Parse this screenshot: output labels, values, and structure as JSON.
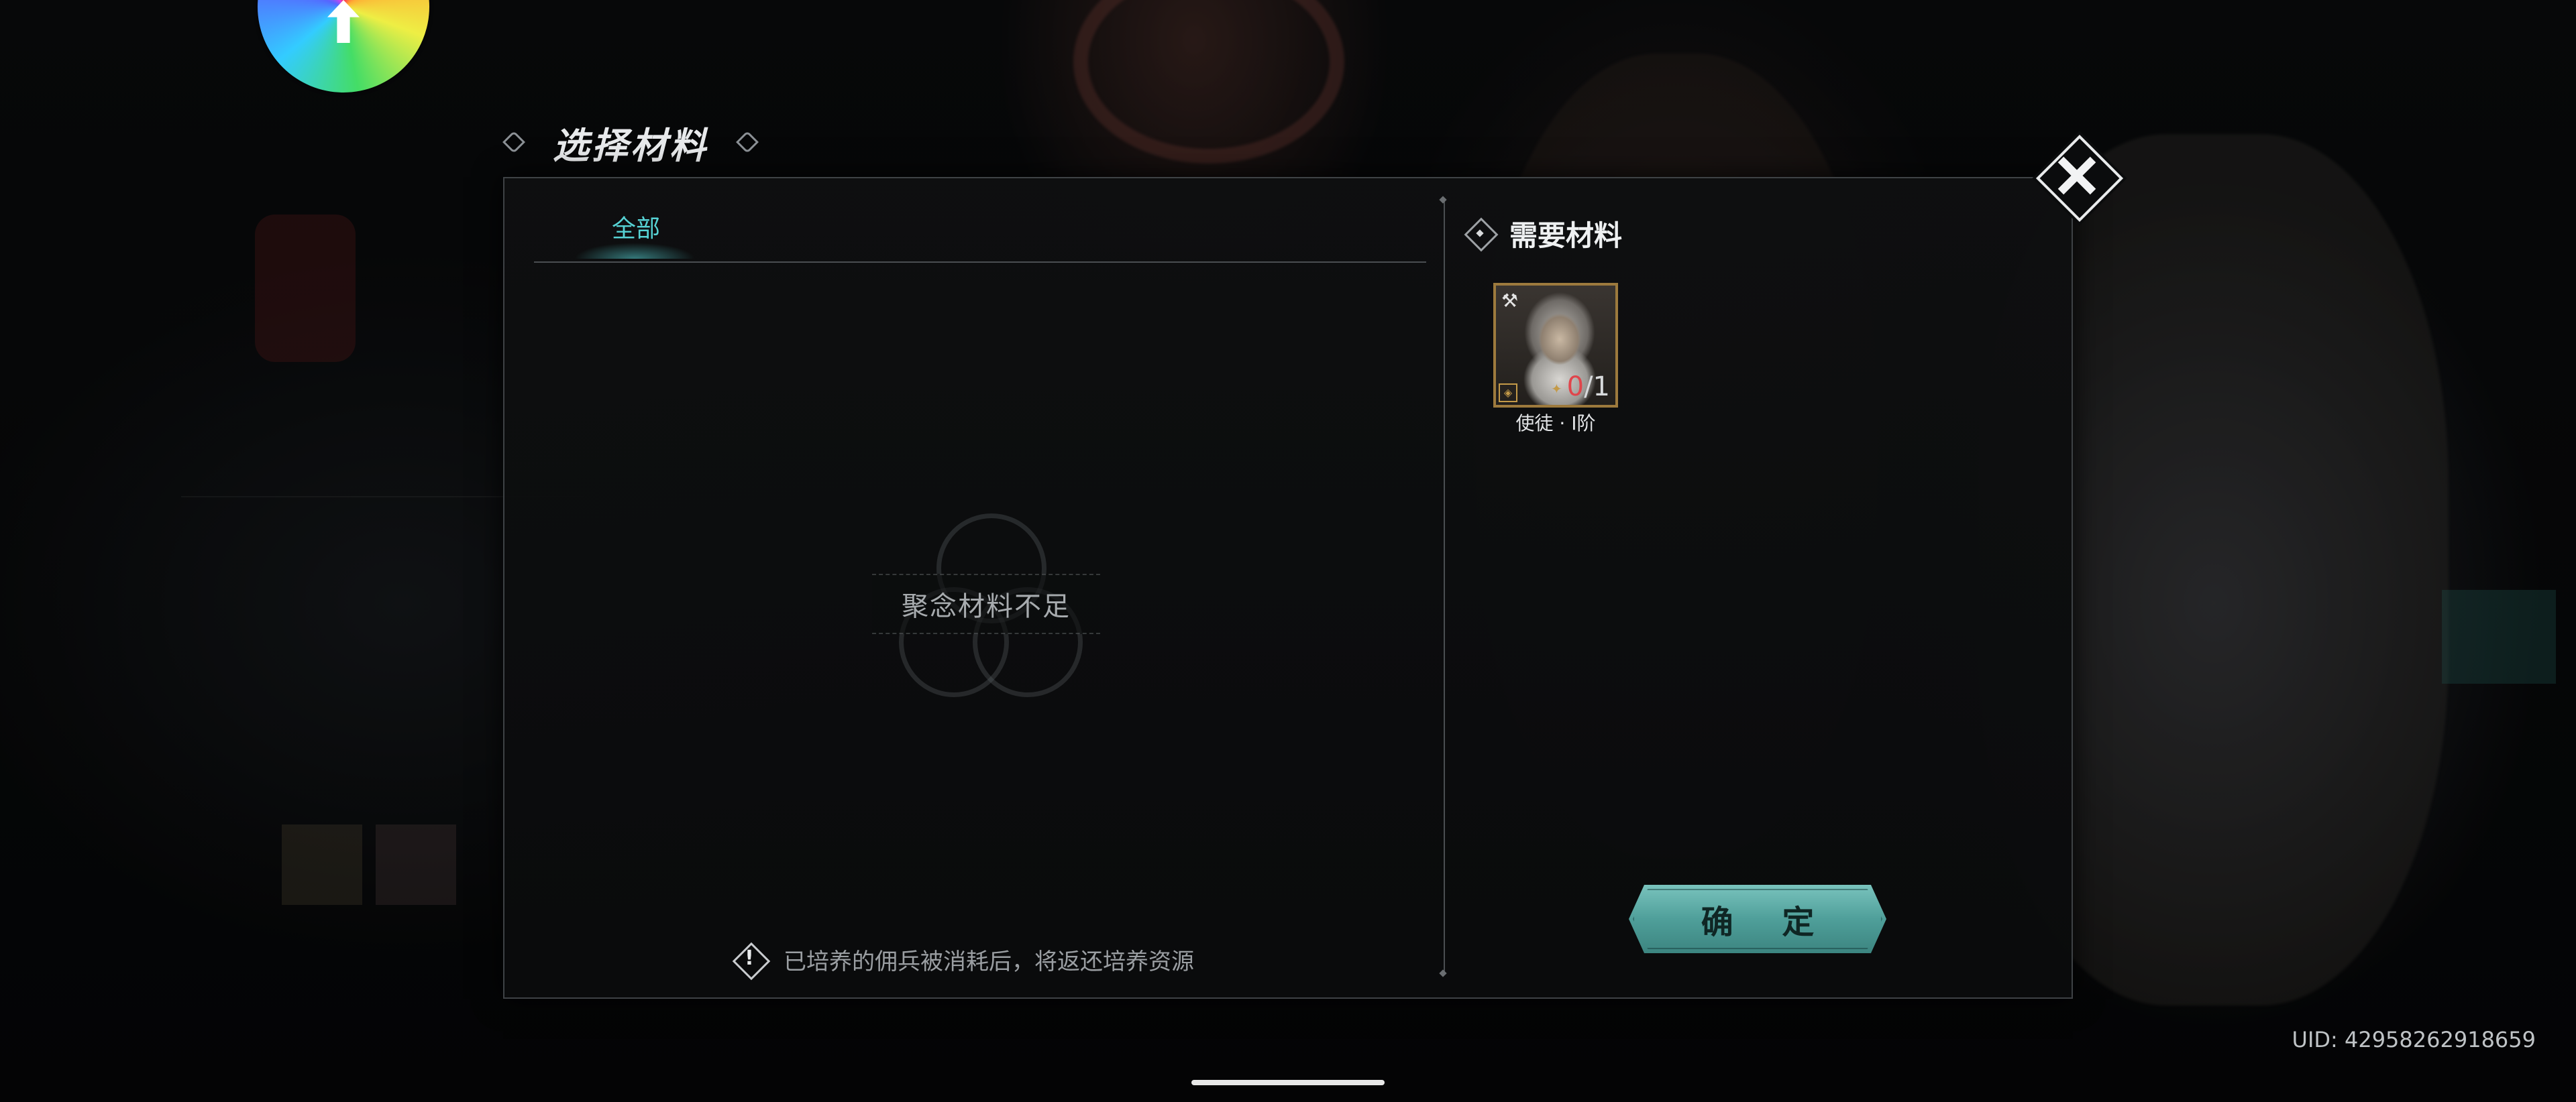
{
  "dialog": {
    "title": "选择材料",
    "tabs": [
      {
        "label": "全部",
        "active": true
      }
    ],
    "empty_message": "聚念材料不足",
    "note": "已培养的佣兵被消耗后，将返还培养资源",
    "close_icon": "close-icon"
  },
  "required": {
    "title": "需要材料",
    "items": [
      {
        "label": "使徒 · Ⅰ阶",
        "have": "0",
        "need": "/1",
        "icon": "axe-icon"
      }
    ]
  },
  "confirm_label": "确 定",
  "uid": "UID: 42958262918659",
  "colors": {
    "accent_teal": "#56d2d4",
    "button_teal": "#5fb0aa",
    "count_red": "#e0454b",
    "frame_gold": "#9d7a3d"
  }
}
